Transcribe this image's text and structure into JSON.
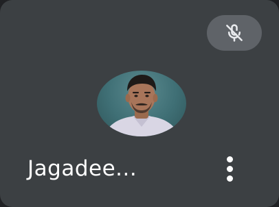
{
  "participant": {
    "name": "Jagadee...",
    "mic_state_icon": "mic-off-icon",
    "options_icon": "more-vert-icon"
  },
  "colors": {
    "tile_background": "#3c4043",
    "badge_background": "#5f6368",
    "text": "#ffffff"
  }
}
